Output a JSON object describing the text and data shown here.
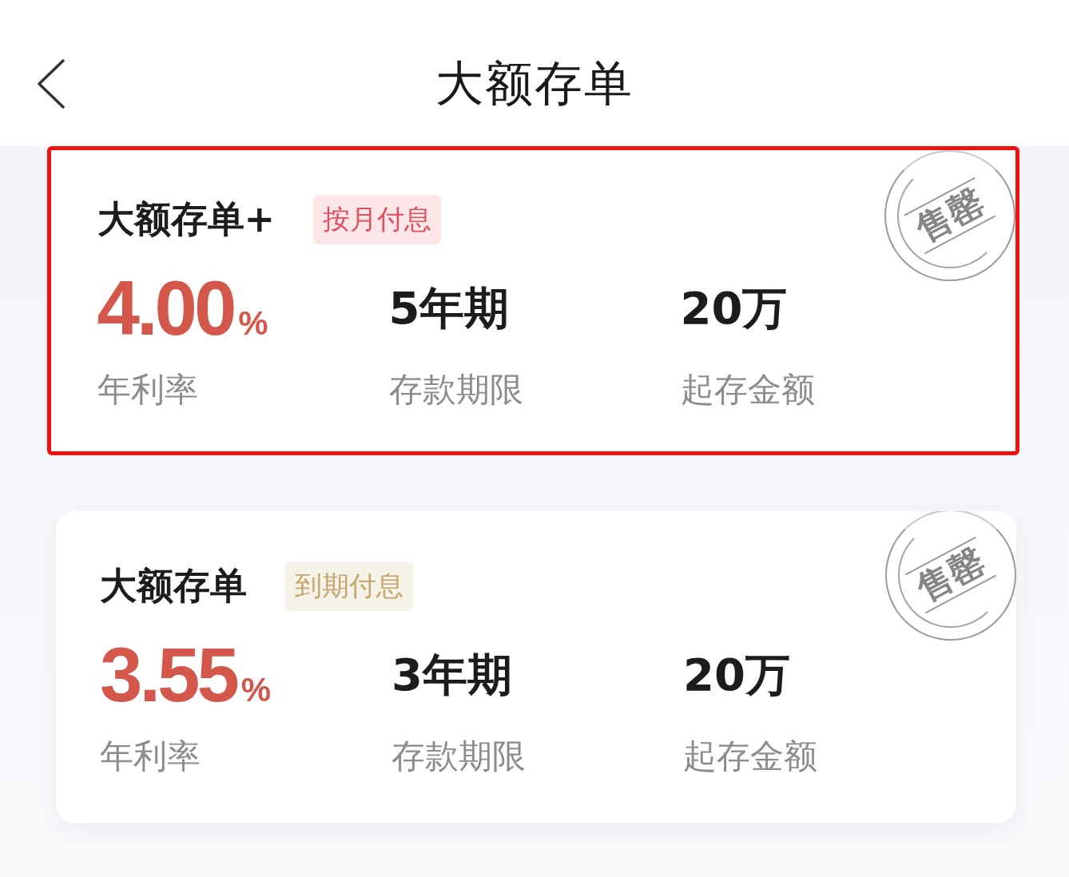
{
  "header": {
    "title": "大额存单"
  },
  "products": [
    {
      "name": "大额存单+",
      "tag": {
        "text": "按月付息",
        "kind": "monthly"
      },
      "rate": "4.00",
      "rate_unit": "%",
      "rate_label": "年利率",
      "term": "5年期",
      "term_label": "存款期限",
      "minimum": "20万",
      "minimum_label": "起存金额",
      "stamp": "售罄",
      "highlighted": true
    },
    {
      "name": "大额存单",
      "tag": {
        "text": "到期付息",
        "kind": "maturity"
      },
      "rate": "3.55",
      "rate_unit": "%",
      "rate_label": "年利率",
      "term": "3年期",
      "term_label": "存款期限",
      "minimum": "20万",
      "minimum_label": "起存金额",
      "stamp": "售罄",
      "highlighted": false
    }
  ]
}
